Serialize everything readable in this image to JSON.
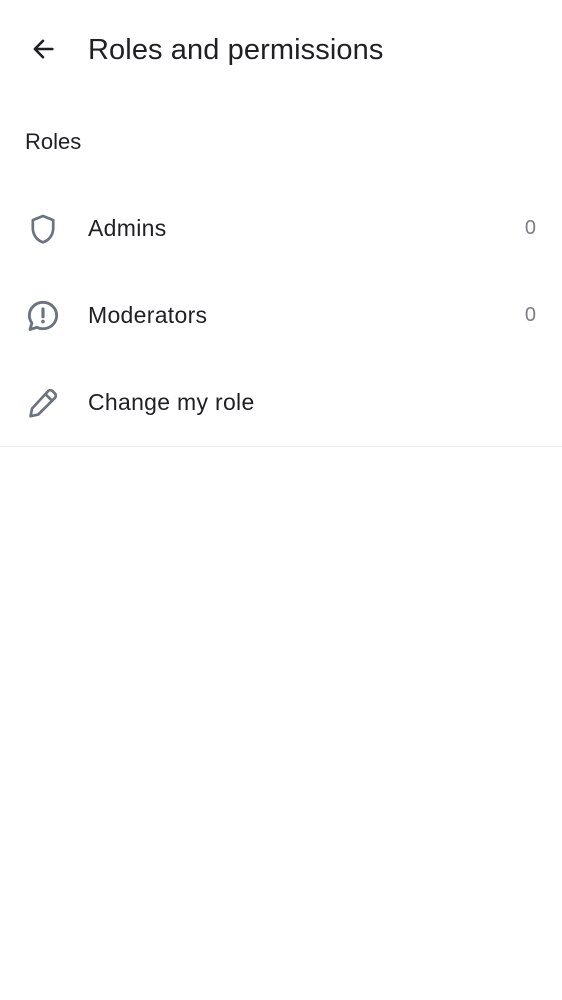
{
  "header": {
    "title": "Roles and permissions",
    "back_icon": "arrow-left-icon"
  },
  "section": {
    "title": "Roles"
  },
  "items": [
    {
      "label": "Admins",
      "count": "0",
      "icon": "shield-icon"
    },
    {
      "label": "Moderators",
      "count": "0",
      "icon": "alert-message-icon"
    },
    {
      "label": "Change my role",
      "count": "",
      "icon": "pencil-icon"
    }
  ],
  "colors": {
    "text": "#1f1f24",
    "icon": "#6b7280",
    "count": "#7a7d86",
    "divider": "#eceef1"
  }
}
